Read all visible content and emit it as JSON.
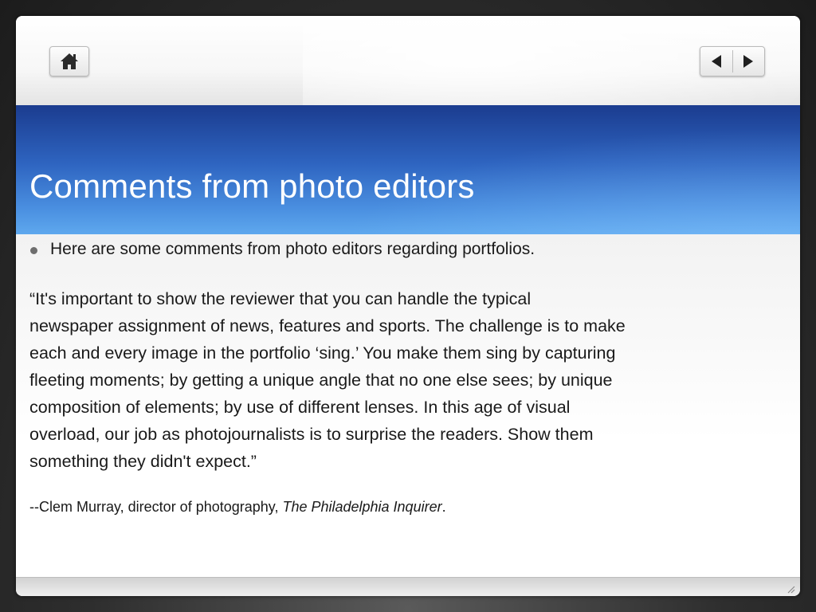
{
  "nav": {
    "home_icon": "home-icon",
    "prev_icon": "triangle-left-icon",
    "next_icon": "triangle-right-icon"
  },
  "slide": {
    "title": "Comments from photo editors",
    "bullet": "Here are some comments from photo editors regarding portfolios.",
    "quote_lines": [
      "“It's important to show the reviewer that you can handle the typical",
      "newspaper assignment of news, features and sports.  The challenge is to make",
      "each and every image in the portfolio ‘sing.’  You make them sing by  capturing",
      "fleeting moments; by getting a unique angle that no one else sees;  by unique",
      "composition of elements; by use of different lenses.  In this age of visual",
      "overload, our job as photojournalists is to surprise the readers.  Show them",
      "something they didn't expect.”"
    ],
    "attribution_prefix": "--Clem Murray, director of photography, ",
    "attribution_publication": "The Philadelphia Inquirer",
    "attribution_suffix": "."
  },
  "colors": {
    "title_band_top": "#1b3c8f",
    "title_band_bottom": "#5ea8ee",
    "title_text": "#ffffff"
  }
}
